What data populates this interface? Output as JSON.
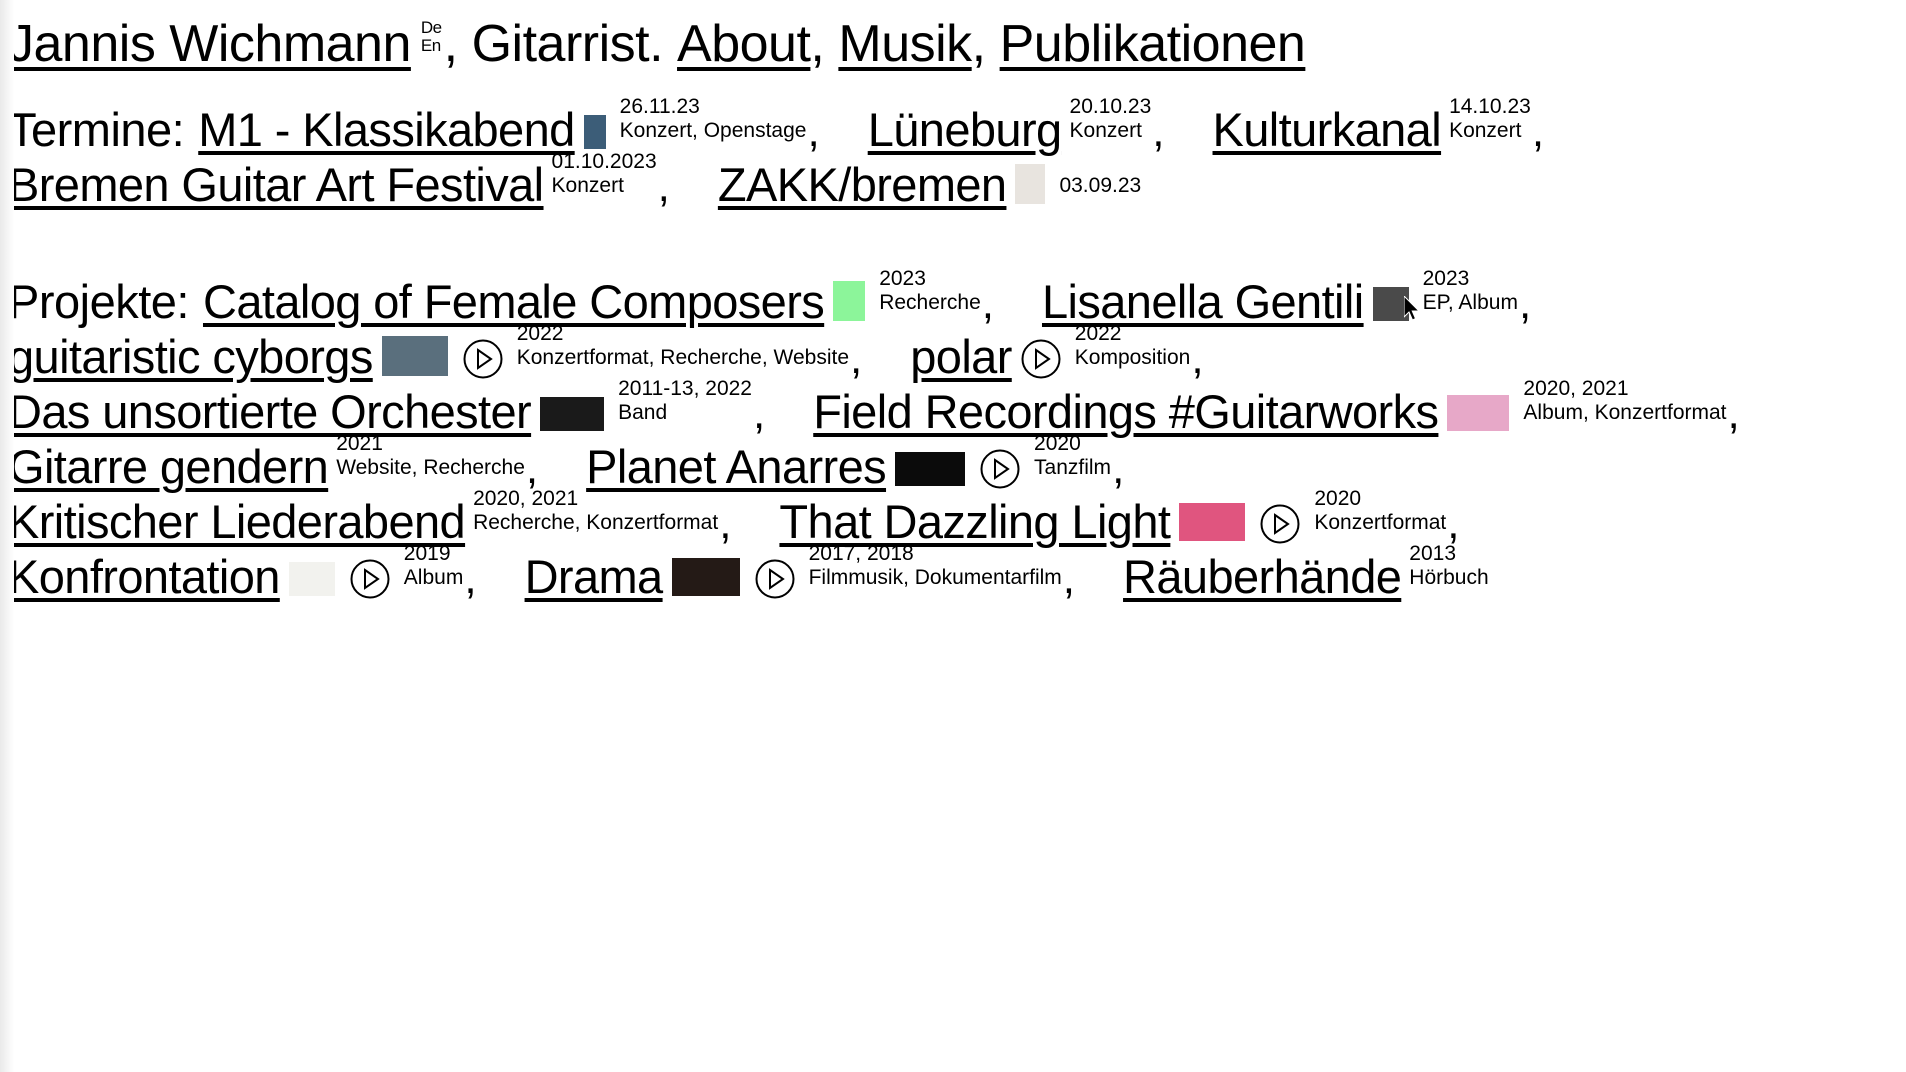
{
  "header": {
    "brand": "Jannis Wichmann",
    "lang": {
      "de": "De",
      "en": "En"
    },
    "comma_after_brand": ",",
    "role": "Gitarrist.",
    "nav": [
      {
        "label": "About",
        "comma": ","
      },
      {
        "label": "Musik",
        "comma": ","
      },
      {
        "label": "Publikationen",
        "comma": ""
      }
    ]
  },
  "termine": {
    "label": "Termine:",
    "entries": [
      {
        "title": "M1 - Klassikabend",
        "date": "26.11.23",
        "tags": "Konzert, Openstage",
        "thumb": "poster-thumbnail",
        "thumb_color": "#3c5d78",
        "has_thumb": true,
        "has_play": false,
        "sep": ","
      },
      {
        "title": "Lüneburg",
        "date": "20.10.23",
        "tags": "Konzert",
        "thumb": "",
        "thumb_color": "",
        "has_thumb": false,
        "has_play": false,
        "sep": ","
      },
      {
        "title": "Kulturkanal",
        "date": "14.10.23",
        "tags": "Konzert",
        "thumb": "",
        "thumb_color": "",
        "has_thumb": false,
        "has_play": false,
        "sep": ","
      },
      {
        "title": "Bremen Guitar Art Festival",
        "date": "01.10.2023",
        "tags": "Konzert",
        "thumb": "",
        "thumb_color": "",
        "has_thumb": false,
        "has_play": false,
        "sep": ","
      },
      {
        "title": "ZAKK/bremen",
        "date": "03.09.23",
        "tags": "",
        "thumb": "flyer-thumbnail",
        "thumb_color": "#e8e4df",
        "has_thumb": true,
        "has_play": false,
        "sep": ""
      }
    ]
  },
  "projekte": {
    "label": "Projekte:",
    "entries": [
      {
        "title": "Catalog of Female Composers",
        "date": "2023",
        "tags": "Recherche",
        "thumb": "green-document-thumbnail",
        "thumb_color": "#8cf59a",
        "has_thumb": true,
        "has_play": false,
        "sep": ","
      },
      {
        "title": "Lisanella Gentili",
        "date": "2023",
        "tags": "EP, Album",
        "thumb": "portrait-thumbnail",
        "thumb_color": "#4a4a4a",
        "has_thumb": true,
        "has_play": false,
        "sep": ","
      },
      {
        "title": "guitaristic cyborgs",
        "date": "2022",
        "tags": "Konzertformat, Recherche, Website",
        "thumb": "cyborg-photo-thumbnail",
        "thumb_color": "#5a6f7d",
        "has_thumb": true,
        "has_play": true,
        "sep": ","
      },
      {
        "title": "polar",
        "date": "2022",
        "tags": "Komposition",
        "thumb": "",
        "thumb_color": "",
        "has_thumb": false,
        "has_play": true,
        "sep": ","
      },
      {
        "title": "Das unsortierte Orchester",
        "date": "2011-13, 2022",
        "tags": "Band",
        "thumb": "orchestra-stage-thumbnail",
        "thumb_color": "#1a1a1a",
        "has_thumb": true,
        "has_play": false,
        "sep": ","
      },
      {
        "title": "Field Recordings #Guitarworks",
        "date": "2020, 2021",
        "tags": "Album, Konzertformat",
        "thumb": "field-recording-thumbnail",
        "thumb_color": "#e7a8c8",
        "has_thumb": true,
        "has_play": false,
        "sep": ","
      },
      {
        "title": "Gitarre gendern",
        "date": "2021",
        "tags": "Website, Recherche",
        "thumb": "",
        "thumb_color": "",
        "has_thumb": false,
        "has_play": false,
        "sep": ","
      },
      {
        "title": "Planet Anarres",
        "date": "2020",
        "tags": "Tanzfilm",
        "thumb": "dark-film-thumbnail",
        "thumb_color": "#0b0b0b",
        "has_thumb": true,
        "has_play": true,
        "sep": ","
      },
      {
        "title": "Kritischer Liederabend",
        "date": "2020, 2021",
        "tags": "Recherche, Konzertformat",
        "thumb": "",
        "thumb_color": "",
        "has_thumb": false,
        "has_play": false,
        "sep": ","
      },
      {
        "title": "That Dazzling Light",
        "date": "2020",
        "tags": "Konzertformat",
        "thumb": "pink-gradient-thumbnail",
        "thumb_color": "#e0557f",
        "has_thumb": true,
        "has_play": true,
        "sep": ","
      },
      {
        "title": "Konfrontation",
        "date": "2019",
        "tags": "Album",
        "thumb": "score-sheet-thumbnail",
        "thumb_color": "#f2f2ee",
        "has_thumb": true,
        "has_play": true,
        "sep": ","
      },
      {
        "title": "Drama",
        "date": "2017, 2018",
        "tags": "Filmmusik, Dokumentarfilm",
        "thumb": "hands-photo-thumbnail",
        "thumb_color": "#241a16",
        "has_thumb": true,
        "has_play": true,
        "sep": ","
      },
      {
        "title": "Räuberhände",
        "date": "2013",
        "tags": "Hörbuch",
        "thumb": "",
        "thumb_color": "",
        "has_thumb": false,
        "has_play": false,
        "sep": ""
      }
    ]
  },
  "icons": {
    "play": "play-circle-icon",
    "cursor": "mouse-pointer-icon"
  }
}
